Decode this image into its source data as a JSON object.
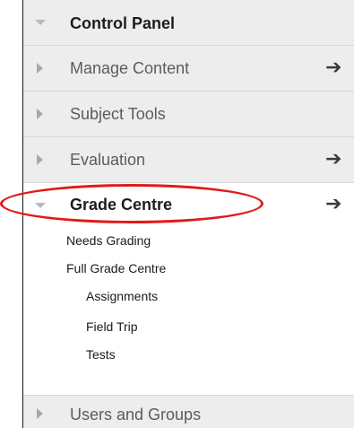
{
  "header": {
    "label": "Control Panel"
  },
  "sections": [
    {
      "label": "Manage Content"
    },
    {
      "label": "Subject Tools"
    },
    {
      "label": "Evaluation"
    }
  ],
  "grade_centre": {
    "label": "Grade Centre",
    "items": [
      "Needs Grading",
      "Full Grade Centre"
    ],
    "subitems": [
      "Assignments",
      "Field Trip",
      "Tests"
    ]
  },
  "users": {
    "label": "Users and Groups"
  },
  "annotation_color": "#e31818"
}
